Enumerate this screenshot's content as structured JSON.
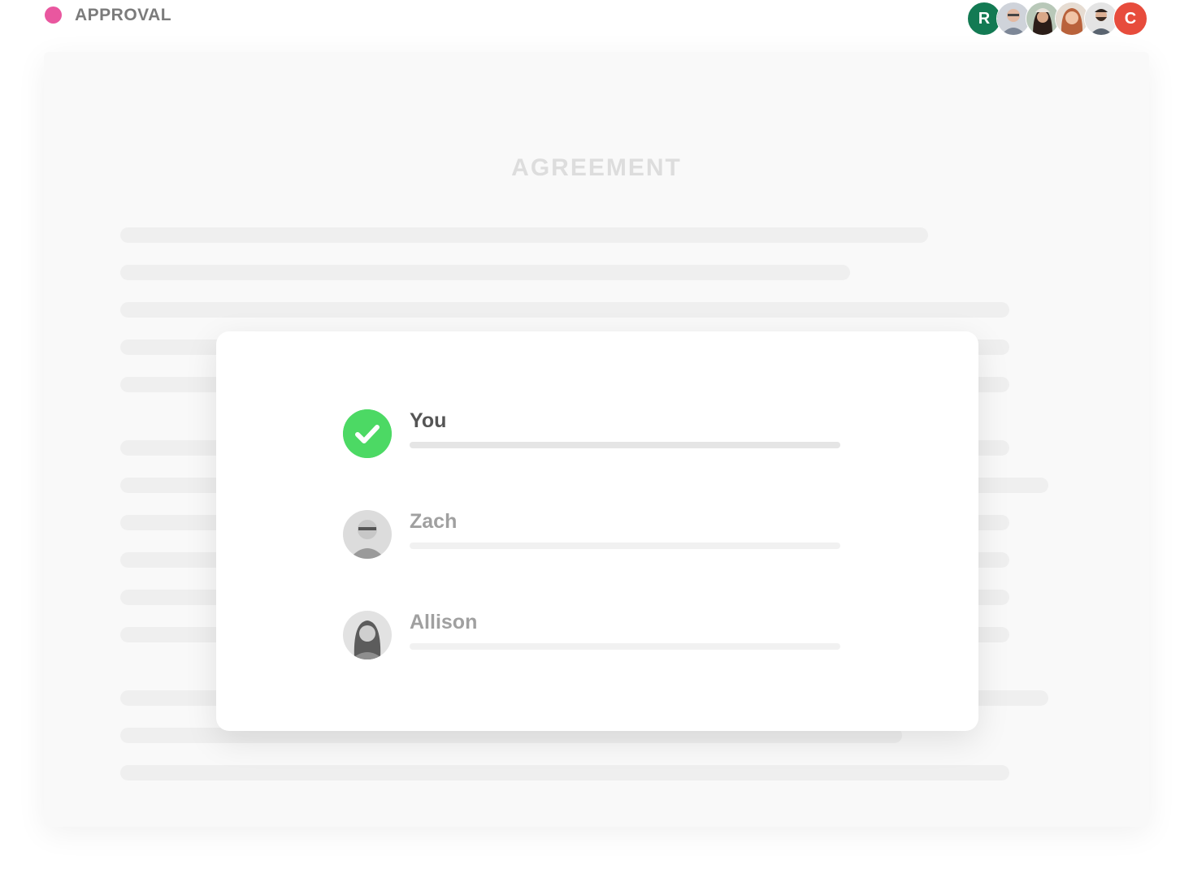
{
  "header": {
    "status_label": "APPROVAL",
    "status_color": "#e9579f",
    "collaborators": [
      {
        "type": "initial",
        "initial": "R",
        "color": "#137a53"
      },
      {
        "type": "photo",
        "name": "avatar-man-glasses"
      },
      {
        "type": "photo",
        "name": "avatar-woman-beanie"
      },
      {
        "type": "photo",
        "name": "avatar-woman-redhair"
      },
      {
        "type": "photo",
        "name": "avatar-man-beard"
      },
      {
        "type": "initial",
        "initial": "C",
        "color": "#e74c3c"
      }
    ]
  },
  "document": {
    "title": "AGREEMENT"
  },
  "approval_modal": {
    "approvers": [
      {
        "name": "You",
        "state": "approved",
        "progress": 1.0
      },
      {
        "name": "Zach",
        "state": "pending",
        "progress": 0.0
      },
      {
        "name": "Allison",
        "state": "pending",
        "progress": 0.0
      }
    ]
  },
  "colors": {
    "approved_green": "#4cd964",
    "placeholder_line": "#efefef"
  }
}
